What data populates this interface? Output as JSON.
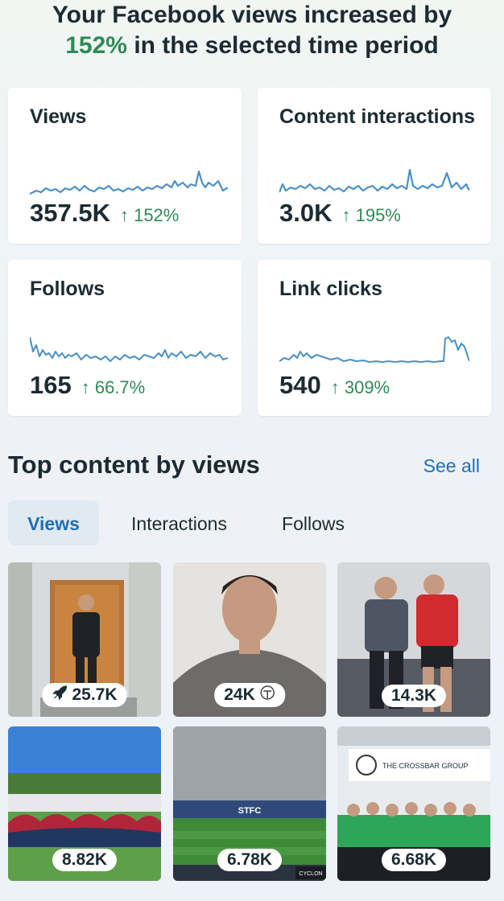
{
  "headline": {
    "line1": "Your Facebook views increased by",
    "percent": "152%",
    "line2_rest": "in the selected time period"
  },
  "colors": {
    "positive": "#2e8a57",
    "accent": "#1d6fb8",
    "sparkline": "#4a90c8"
  },
  "metrics": [
    {
      "title": "Views",
      "value": "357.5K",
      "change": "↑ 152%"
    },
    {
      "title": "Content interactions",
      "value": "3.0K",
      "change": "↑ 195%"
    },
    {
      "title": "Follows",
      "value": "165",
      "change": "↑ 66.7%"
    },
    {
      "title": "Link clicks",
      "value": "540",
      "change": "↑ 309%"
    }
  ],
  "top_content": {
    "title": "Top content by views",
    "see_all": "See all",
    "tabs": [
      "Views",
      "Interactions",
      "Follows"
    ],
    "active_tab": "Views",
    "items": [
      {
        "views": "25.7K",
        "icon": "boost-rocket-icon"
      },
      {
        "views": "24K",
        "icon": "logo-icon"
      },
      {
        "views": "14.3K"
      },
      {
        "views": "8.82K"
      },
      {
        "views": "6.78K"
      },
      {
        "views": "6.68K"
      }
    ],
    "thumbnail_text": {
      "banner_name": "THE CROSSBAR GROUP",
      "stand_text": "STFC",
      "sponsor_text": "CYCLON"
    }
  }
}
